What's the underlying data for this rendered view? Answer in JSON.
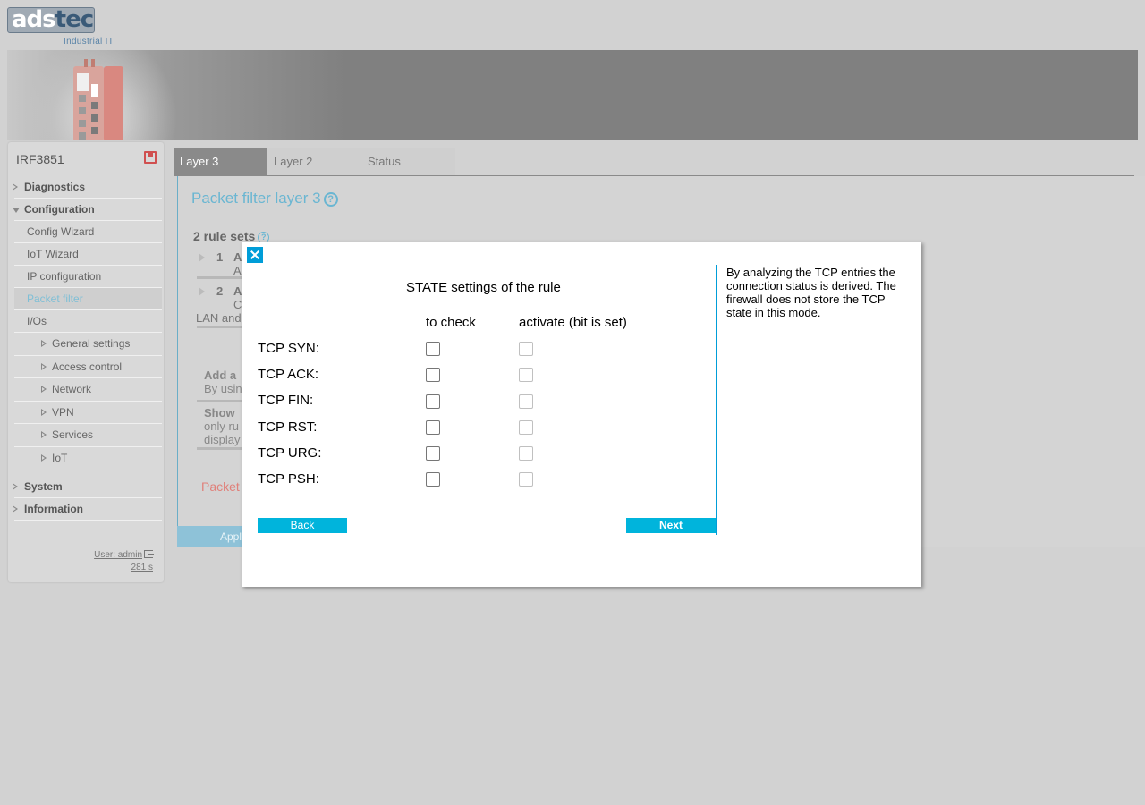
{
  "logo": {
    "part1": "ads",
    "part2": "tec",
    "subtitle": "Industrial IT"
  },
  "sidebar": {
    "device_name": "IRF3851",
    "items": [
      {
        "label": "Diagnostics"
      },
      {
        "label": "Configuration"
      },
      {
        "label": "Config Wizard"
      },
      {
        "label": "IoT Wizard"
      },
      {
        "label": "IP configuration"
      },
      {
        "label": "Packet filter"
      },
      {
        "label": "I/Os"
      },
      {
        "label": "General settings"
      },
      {
        "label": "Access control"
      },
      {
        "label": "Network"
      },
      {
        "label": "VPN"
      },
      {
        "label": "Services"
      },
      {
        "label": "IoT"
      },
      {
        "label": "System"
      },
      {
        "label": "Information"
      }
    ],
    "user": "User: admin",
    "timer": "281 s"
  },
  "tabs": [
    {
      "label": "Layer 3"
    },
    {
      "label": "Layer 2"
    },
    {
      "label": "Status"
    }
  ],
  "main": {
    "title": "Packet filter layer 3",
    "rulesets_title": "2 rule sets",
    "rules": [
      {
        "num": "1",
        "name": "A",
        "desc": "A"
      },
      {
        "num": "2",
        "name": "A",
        "desc": "C",
        "desc2": "LAN and"
      }
    ],
    "add_title": "Add a",
    "add_desc": "By usin",
    "show_title": "Show",
    "show_desc1": "only ru",
    "show_desc2": "display",
    "packet_red": "Packet",
    "apply": "Appl"
  },
  "modal": {
    "title": "STATE settings of the rule",
    "col_check": "to check",
    "col_activate": "activate (bit is set)",
    "rows": [
      {
        "label": "TCP SYN:"
      },
      {
        "label": "TCP ACK:"
      },
      {
        "label": "TCP FIN:"
      },
      {
        "label": "TCP RST:"
      },
      {
        "label": "TCP URG:"
      },
      {
        "label": "TCP PSH:"
      }
    ],
    "back": "Back",
    "next": "Next",
    "help": "By analyzing the TCP entries the connection status is derived. The firewall does not store the TCP state in this mode."
  },
  "colors": {
    "accent": "#009dd8",
    "button": "#00b4dc",
    "link": "#6ab6d2"
  }
}
